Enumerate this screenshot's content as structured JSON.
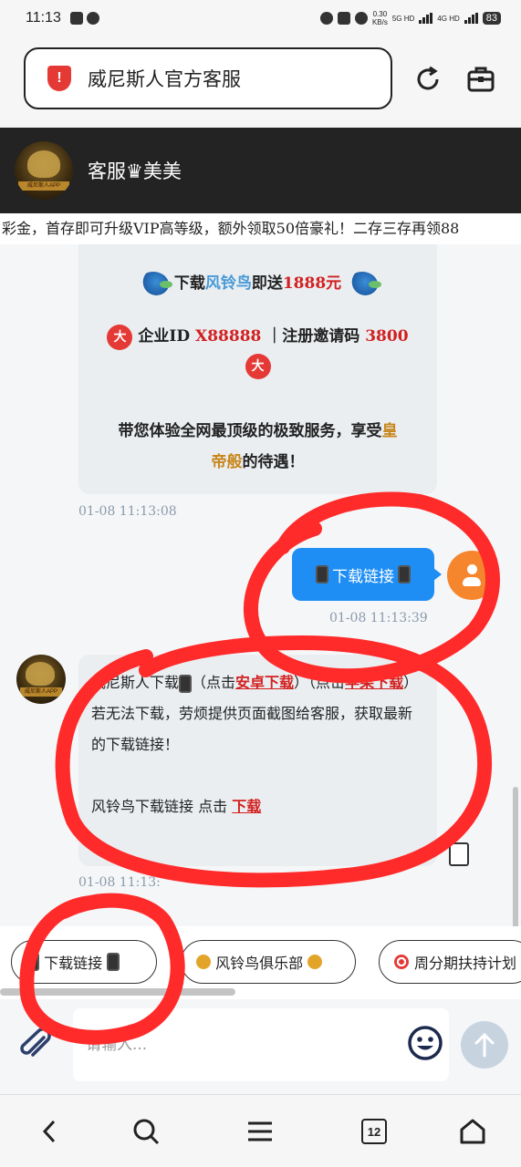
{
  "status_bar": {
    "time": "11:13",
    "net_speed": "0.30\nKB/s",
    "net1": "5G HD",
    "net2": "4G HD",
    "battery": "83"
  },
  "browser": {
    "url_title": "威尼斯人官方客服",
    "shield_symbol": "!"
  },
  "header": {
    "agent_name": "客服♛美美"
  },
  "marquee": {
    "text": "彩金，首存即可升级VIP高等级，额外领取50倍豪礼！二存三存再领88"
  },
  "promo": {
    "line1_prefix": "下载",
    "line1_app": "风铃鸟",
    "line1_mid": "即送",
    "line1_amount": "1888元",
    "da_char": "大",
    "line2_label": "企业ID",
    "line2_id": "X88888",
    "line2_sep": "｜注册邀请码",
    "line2_code": "3800",
    "line3a": "带您体验全网最顶级的极致服务，享受",
    "line3_gold1": "皇",
    "line3_gold2": "帝般",
    "line3_end": "的待遇！",
    "timestamp": "01-08 11:13:08"
  },
  "sent_message": {
    "text": "下载链接",
    "timestamp": "01-08 11:13:39"
  },
  "received_message": {
    "p1_start": "威尼斯人下载",
    "p1_mid": "（点击",
    "link_android": "安卓下载",
    "p1_end": "）（点击",
    "link_apple": "苹果下载",
    "p1_close": "）",
    "p2": "若无法下载，劳烦提供页面截图给客服，获取最新的下载链接！",
    "p3_start": "风铃鸟下载链接 点击",
    "link_download": "下载",
    "timestamp": "01-08 11:13:"
  },
  "quick_replies": [
    {
      "label": "下载链接"
    },
    {
      "label": "风铃鸟俱乐部"
    },
    {
      "label": "周分期扶持计划"
    }
  ],
  "input": {
    "placeholder": "请输入..."
  },
  "bottom_nav": {
    "tab_count": "12"
  },
  "avatar_tag": "威尼斯人APP"
}
